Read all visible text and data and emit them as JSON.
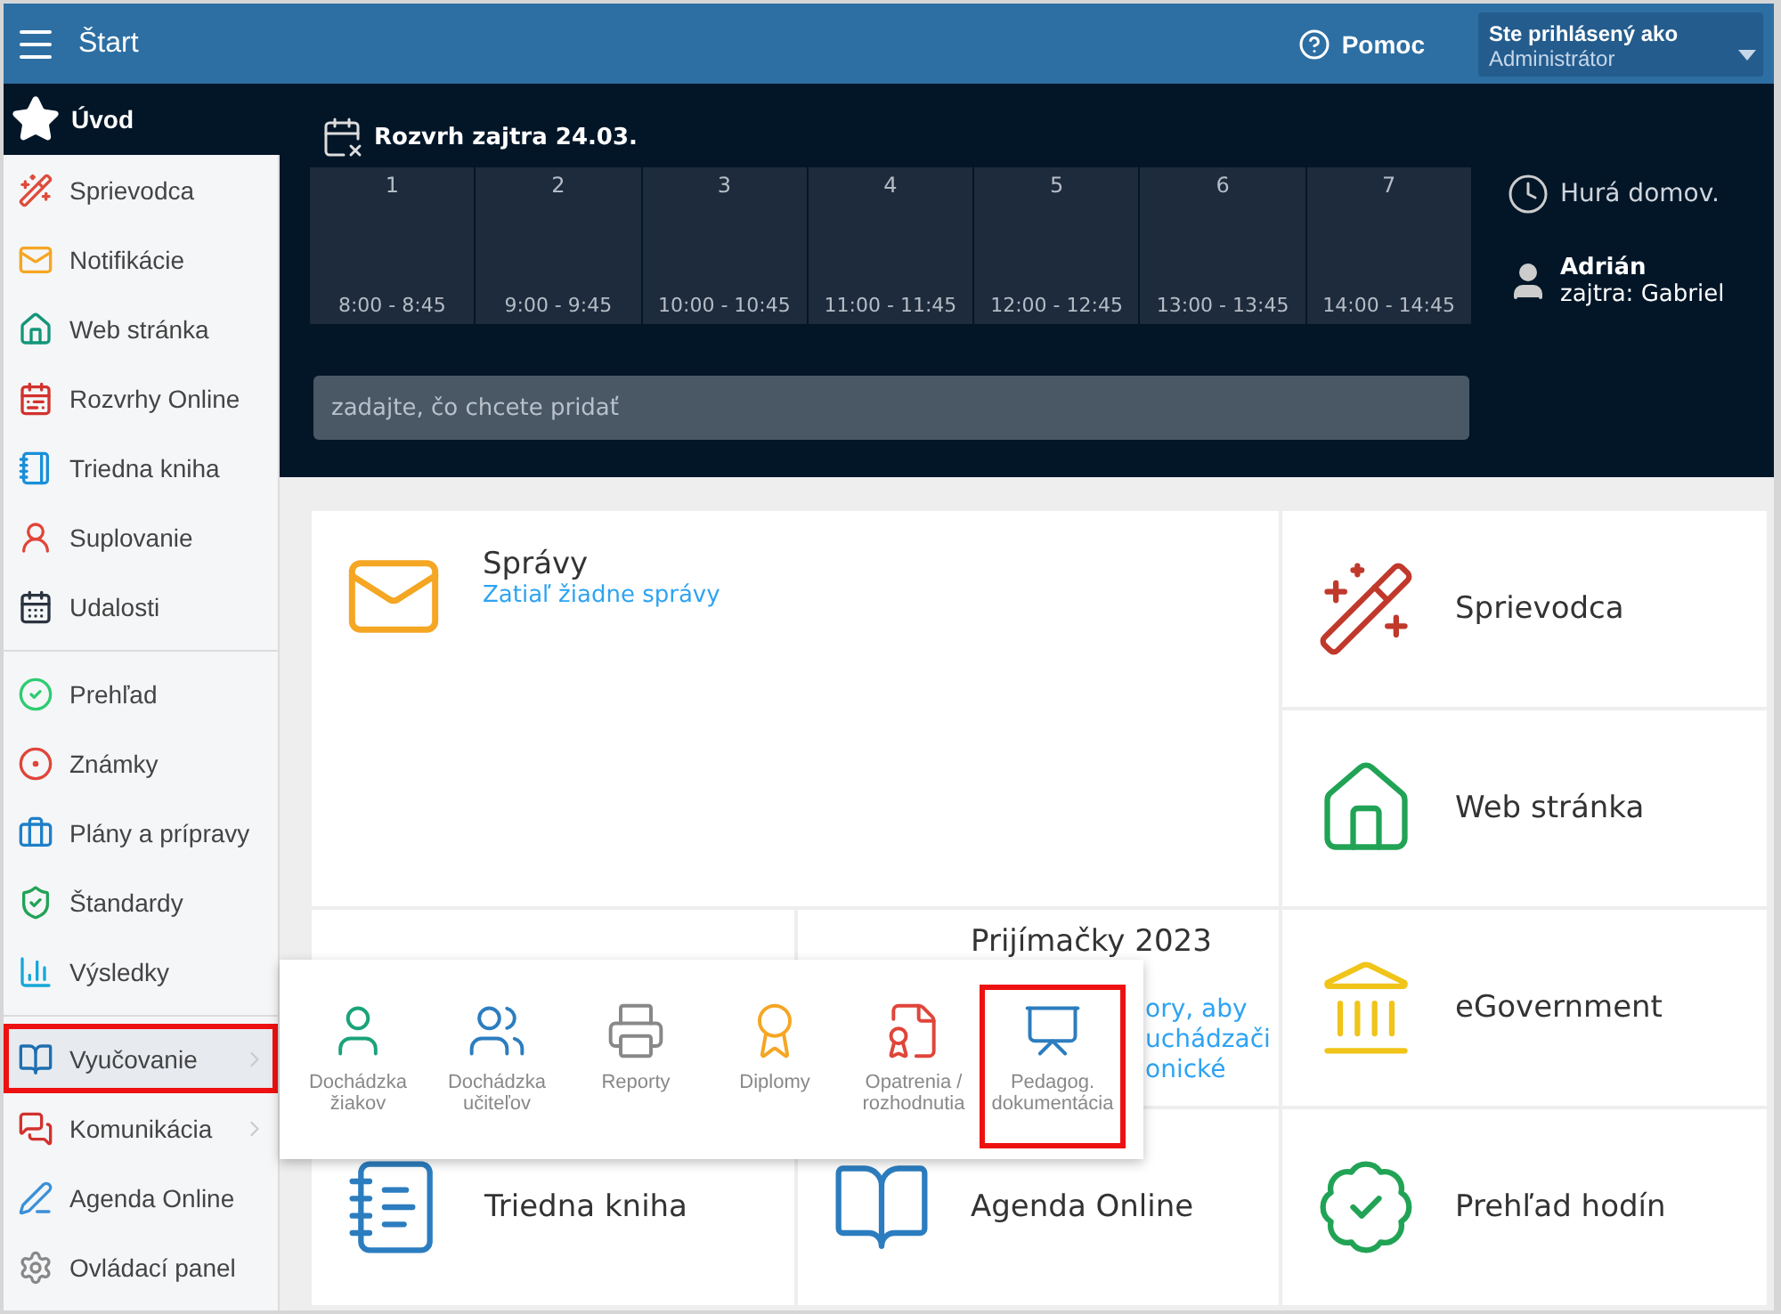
{
  "topbar": {
    "title": "Štart",
    "help": "Pomoc",
    "user_label": "Ste prihlásený ako",
    "user_role": "Administrátor"
  },
  "sidebar": {
    "home": "Úvod",
    "groups": [
      [
        {
          "label": "Sprievodca",
          "selected": false,
          "highlighted": false,
          "submenu": false
        },
        {
          "label": "Notifikácie",
          "selected": false,
          "highlighted": false,
          "submenu": false
        },
        {
          "label": "Web stránka",
          "selected": false,
          "highlighted": false,
          "submenu": false
        },
        {
          "label": "Rozvrhy Online",
          "selected": false,
          "highlighted": false,
          "submenu": false
        },
        {
          "label": "Triedna kniha",
          "selected": false,
          "highlighted": false,
          "submenu": false
        },
        {
          "label": "Suplovanie",
          "selected": false,
          "highlighted": false,
          "submenu": false
        },
        {
          "label": "Udalosti",
          "selected": false,
          "highlighted": false,
          "submenu": false
        }
      ],
      [
        {
          "label": "Prehľad",
          "selected": false,
          "highlighted": false,
          "submenu": false
        },
        {
          "label": "Známky",
          "selected": false,
          "highlighted": false,
          "submenu": false
        },
        {
          "label": "Plány a prípravy",
          "selected": false,
          "highlighted": false,
          "submenu": false
        },
        {
          "label": "Štandardy",
          "selected": false,
          "highlighted": false,
          "submenu": false
        },
        {
          "label": "Výsledky",
          "selected": false,
          "highlighted": false,
          "submenu": false
        }
      ],
      [
        {
          "label": "Vyučovanie",
          "selected": true,
          "highlighted": true,
          "submenu": true
        },
        {
          "label": "Komunikácia",
          "selected": false,
          "highlighted": false,
          "submenu": true
        },
        {
          "label": "Agenda Online",
          "selected": false,
          "highlighted": false,
          "submenu": false
        },
        {
          "label": "Ovládací panel",
          "selected": false,
          "highlighted": false,
          "submenu": false
        }
      ]
    ]
  },
  "schedule": {
    "title": "Rozvrh zajtra 24.03.",
    "periods": [
      {
        "number": "1",
        "time": "8:00 - 8:45"
      },
      {
        "number": "2",
        "time": "9:00 - 9:45"
      },
      {
        "number": "3",
        "time": "10:00 - 10:45"
      },
      {
        "number": "4",
        "time": "11:00 - 11:45"
      },
      {
        "number": "5",
        "time": "12:00 - 12:45"
      },
      {
        "number": "6",
        "time": "13:00 - 13:45"
      },
      {
        "number": "7",
        "time": "14:00 - 14:45"
      }
    ],
    "placeholder": "zadajte, čo chcete pridať",
    "status": "Hurá domov.",
    "person": "Adrián",
    "tomorrow": "zajtra: Gabriel"
  },
  "tiles": [
    {
      "kind": "messages",
      "title": "Správy",
      "subtitle": "Zatiaľ žiadne správy"
    },
    {
      "kind": "link",
      "title": "Sprievodca"
    },
    {
      "kind": "link",
      "title": "Web stránka"
    },
    {
      "kind": "blank"
    },
    {
      "kind": "partial",
      "title": "Prijímačky 2023",
      "lines": [
        "ory, aby",
        "uchádzači",
        "onické"
      ]
    },
    {
      "kind": "link",
      "title": "eGovernment"
    },
    {
      "kind": "link",
      "title": "Triedna kniha"
    },
    {
      "kind": "link",
      "title": "Agenda Online"
    },
    {
      "kind": "link",
      "title": "Prehľad hodín"
    }
  ],
  "popup": {
    "items": [
      {
        "label": "Dochádzka žiakov",
        "highlighted": false
      },
      {
        "label": "Dochádzka učiteľov",
        "highlighted": false
      },
      {
        "label": "Reporty",
        "highlighted": false
      },
      {
        "label": "Diplomy",
        "highlighted": false
      },
      {
        "label": "Opatrenia / rozhodnutia",
        "highlighted": false
      },
      {
        "label": "Pedagog. dokumentácia",
        "highlighted": true
      }
    ]
  }
}
